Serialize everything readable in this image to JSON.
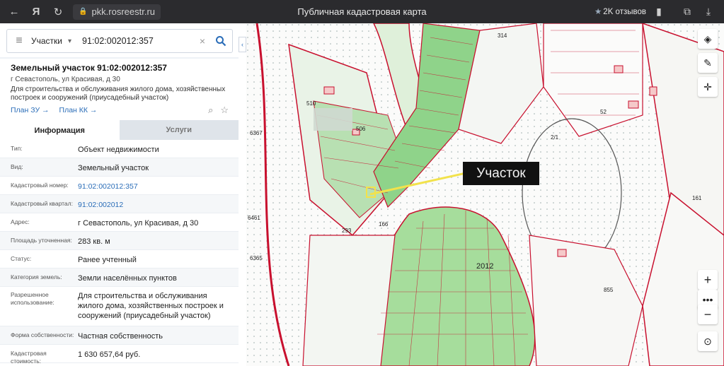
{
  "browser": {
    "url": "pkk.rosreestr.ru",
    "title": "Публичная кадастровая карта",
    "reviews": "2K отзывов",
    "yandex": "Я"
  },
  "search": {
    "type": "Участки",
    "value": "91:02:002012:357"
  },
  "parcel": {
    "title": "Земельный участок 91:02:002012:357",
    "address": "г Севастополь, ул Красивая, д 30",
    "purpose": "Для строительства и обслуживания жилого дома, хозяйственных построек и сооружений (приусадебный участок)",
    "plan_zu": "План ЗУ →",
    "plan_kk": "План КК →"
  },
  "tabs": {
    "info": "Информация",
    "services": "Услуги"
  },
  "rows": [
    {
      "k": "Тип:",
      "v": "Объект недвижимости"
    },
    {
      "k": "Вид:",
      "v": "Земельный участок"
    },
    {
      "k": "Кадастровый номер:",
      "v": "91:02:002012:357"
    },
    {
      "k": "Кадастровый квартал:",
      "v": "91:02:002012"
    },
    {
      "k": "Адрес:",
      "v": "г Севастополь, ул Красивая, д 30"
    },
    {
      "k": "Площадь уточненная:",
      "v": "283 кв. м"
    },
    {
      "k": "Статус:",
      "v": "Ранее учтенный"
    },
    {
      "k": "Категория земель:",
      "v": "Земли населённых пунктов"
    },
    {
      "k": "Разрешенное использование:",
      "v": "Для строительства и обслуживания жилого дома, хозяйственных построек и сооружений (приусадебный участок)"
    },
    {
      "k": "Форма собственности:",
      "v": "Частная собственность"
    },
    {
      "k": "Кадастровая стоимость:",
      "v": "1 630 657,64 руб."
    }
  ],
  "map": {
    "callout": "Участок",
    "block_label": "2012",
    "labels": [
      "510",
      "506",
      "293",
      "166",
      "314",
      "2/1",
      "161",
      "6367",
      "6461",
      "6365",
      "855",
      "52"
    ]
  },
  "colors": {
    "accent": "#2a6db8",
    "parcel_line": "#c8102e",
    "parcel_fill": "#9fd69a",
    "callout_bg": "#111111"
  }
}
